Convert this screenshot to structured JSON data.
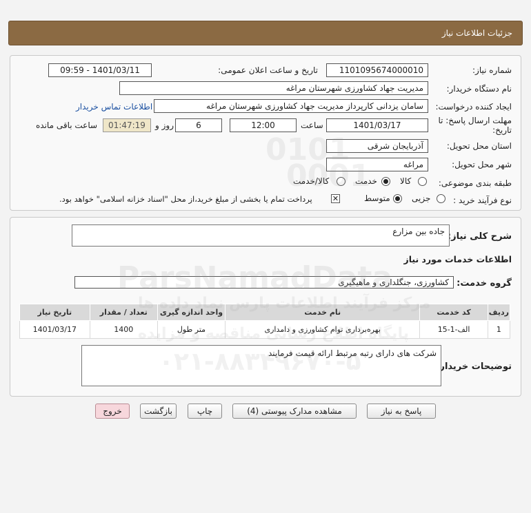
{
  "header": {
    "title": "جزئیات اطلاعات نیاز"
  },
  "form": {
    "need_number_label": "شماره نیاز:",
    "need_number": "1101095674000010",
    "announce_label": "تاریخ و ساعت اعلان عمومی:",
    "announce_value": "1401/03/11 - 09:59",
    "buyer_org_label": "نام دستگاه خریدار:",
    "buyer_org": "مدیریت جهاد کشاورزی شهرستان مراغه",
    "requester_label": "ایجاد کننده درخواست:",
    "requester": "سامان یزدانی کارپرداز مدیریت جهاد کشاورزی شهرستان مراغه",
    "contact_link": "اطلاعات تماس خریدار",
    "deadline_label_1": "مهلت ارسال پاسخ: تا",
    "deadline_label_2": "تاریخ:",
    "deadline_date": "1401/03/17",
    "time_label": "ساعت",
    "deadline_time": "12:00",
    "days_value": "6",
    "days_label": "روز و",
    "remaining_time": "01:47:19",
    "remaining_label": "ساعت باقی مانده",
    "province_label": "استان محل تحویل:",
    "province": "آذربایجان شرقی",
    "city_label": "شهر محل تحویل:",
    "city": "مراغه",
    "category_label": "طبقه بندی موضوعی:",
    "category_options": [
      "کالا",
      "خدمت",
      "کالا/خدمت"
    ],
    "category_selected": "خدمت",
    "purchase_type_label": "نوع فرآیند خرید :",
    "purchase_options": [
      "جزیی",
      "متوسط"
    ],
    "purchase_selected": "متوسط",
    "payment_note": "پرداخت تمام یا بخشی از مبلغ خرید،از محل \"اسناد خزانه اسلامی\" خواهد بود."
  },
  "details": {
    "summary_label": "شرح کلی نیاز:",
    "summary": "جاده بین مزارع",
    "services_heading": "اطلاعات خدمات مورد نیاز",
    "service_group_label": "گروه خدمت:",
    "service_group": "کشاورزی، جنگلداری و ماهیگیری",
    "table": {
      "headers": [
        "ردیف",
        "کد خدمت",
        "نام خدمت",
        "واحد اندازه گیری",
        "تعداد / مقدار",
        "تاریخ نیاز"
      ],
      "rows": [
        [
          "1",
          "الف-1-15",
          "بهره‌برداری توام کشاورزی و دامداری",
          "متر طول",
          "1400",
          "1401/03/17"
        ]
      ]
    },
    "buyer_notes_label": "توضیحات خریدار:",
    "buyer_notes": "شرکت های دارای رتبه  مرتبط ارائه قیمت فرمایند"
  },
  "buttons": {
    "reply": "پاسخ به نیاز",
    "attachments": "مشاهده مدارک پیوستی (4)",
    "print": "چاپ",
    "back": "بازگشت",
    "exit": "خروج"
  },
  "watermark": {
    "line1": "0101",
    "line2": "0001",
    "line3": "ParsNamadData",
    "line4": "مرکز فرآیند اطلاعات پارس نماد داده ها",
    "line5": "پایگاه اطلاع رسانی مناقصه و مزایده",
    "line6": "۰۲۱-۸۸۳۴۹۶۷۰-۵"
  },
  "colors": {
    "header_bg": "#8b6a43",
    "timer_bg": "#efe6c8",
    "link": "#1a4fa0",
    "exit_button": "#f7d7dc"
  }
}
